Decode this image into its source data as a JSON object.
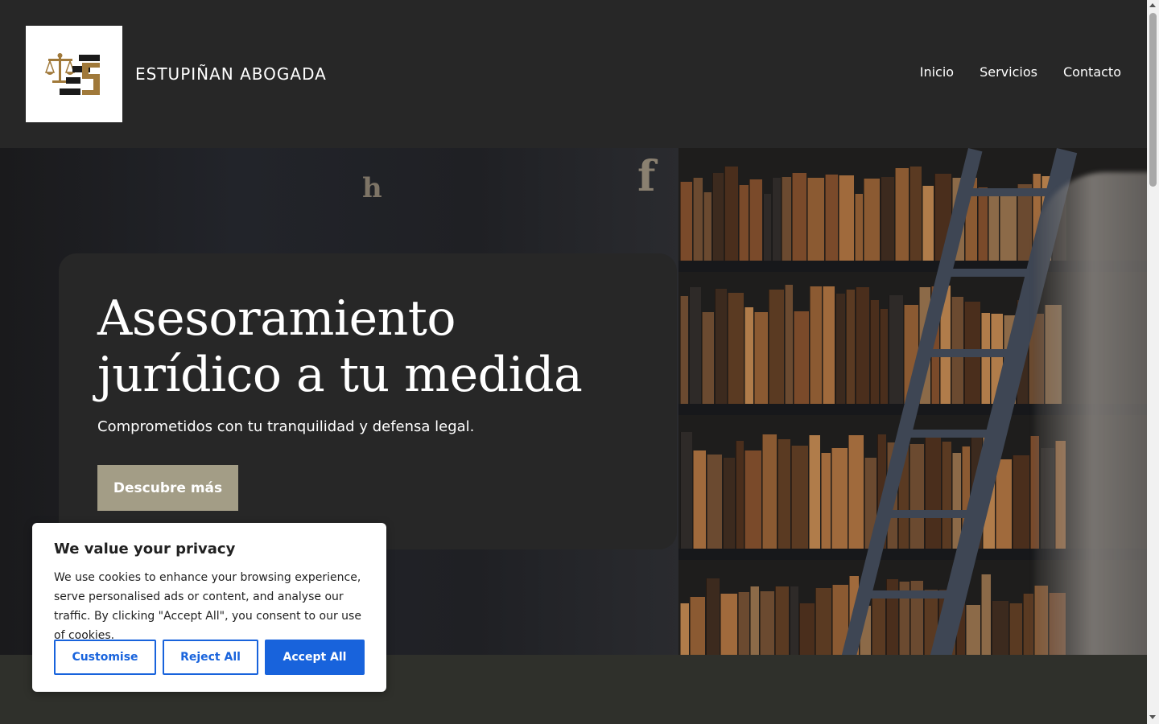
{
  "header": {
    "brand": "ESTUPIÑAN ABOGADA",
    "nav": [
      "Inicio",
      "Servicios",
      "Contacto"
    ]
  },
  "hero": {
    "title": "Asesoramiento jurídico a tu medida",
    "subtitle": "Comprometidos con tu tranquilidad y defensa legal.",
    "button": "Descubre más"
  },
  "cookie": {
    "title": "We value your privacy",
    "text": "We use cookies to enhance your browsing experience, serve personalised ads or content, and analyse our traffic. By clicking \"Accept All\", you consent to our use of cookies.",
    "customise": "Customise",
    "reject": "Reject All",
    "accept": "Accept All"
  },
  "colors": {
    "header_bg": "#272727",
    "hero_button": "#a39d86",
    "accept_button": "#1863dc",
    "logo_gold": "#a0793a"
  }
}
